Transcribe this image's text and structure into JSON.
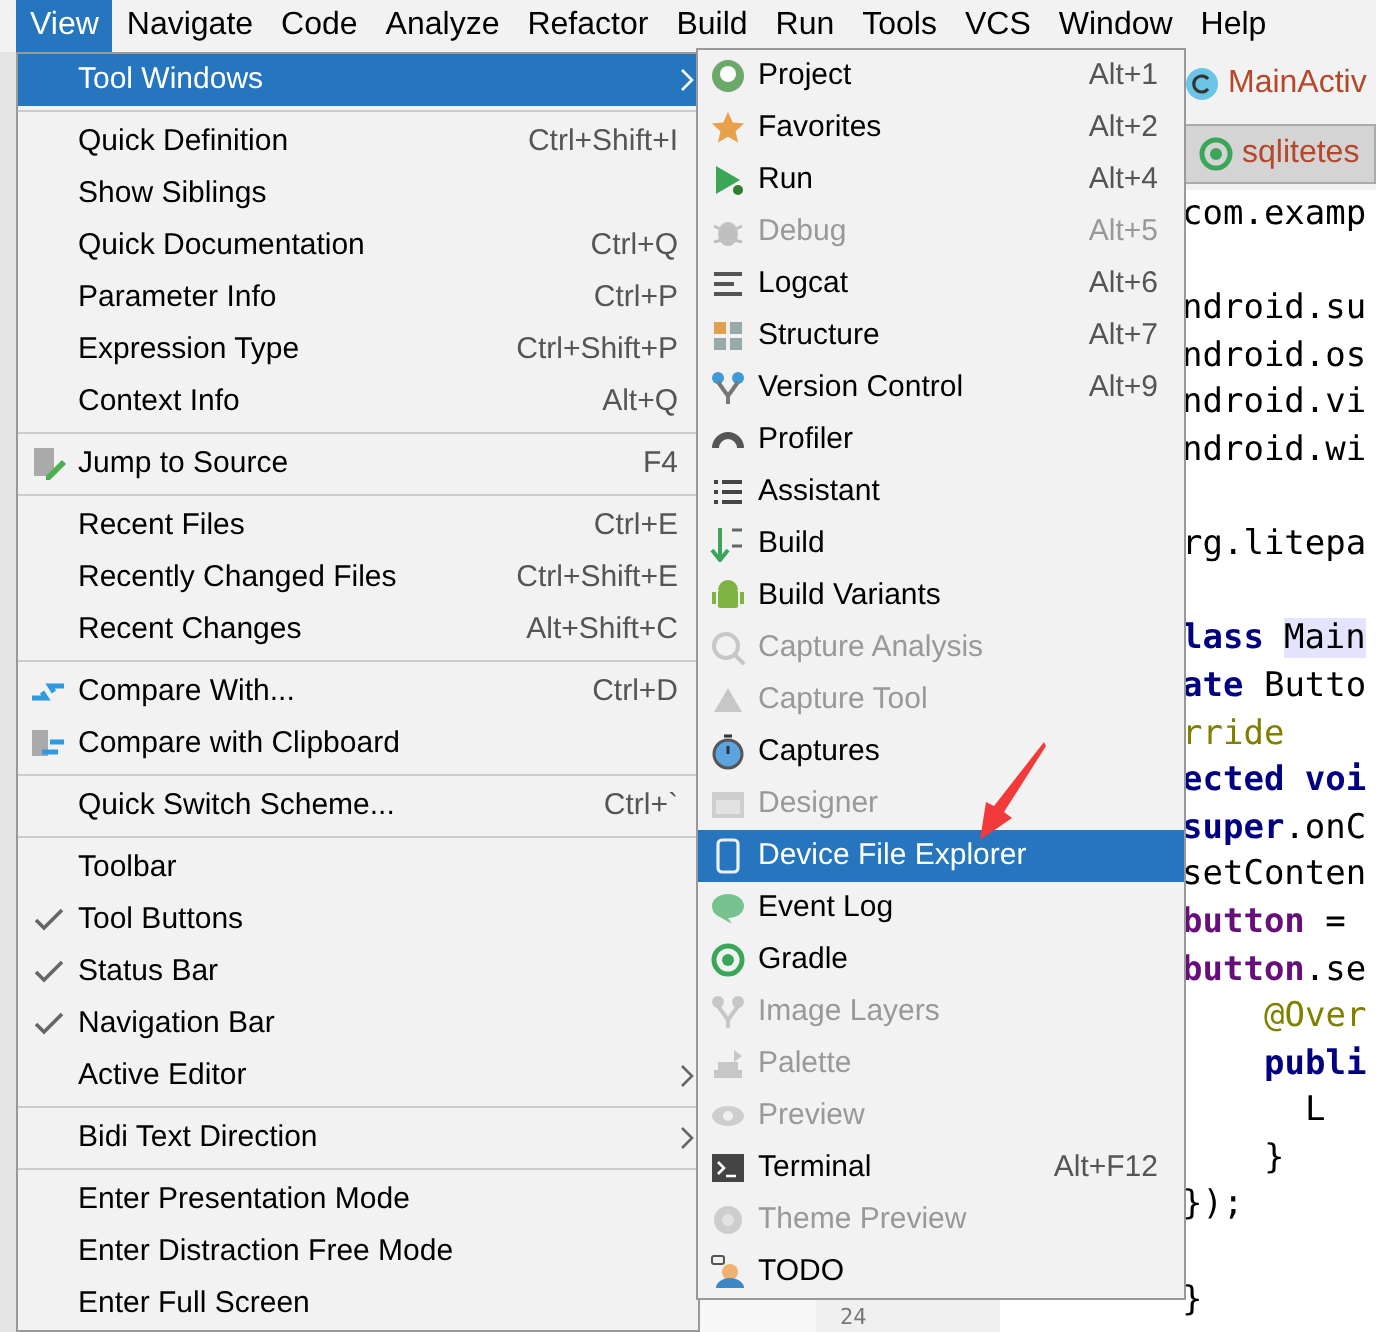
{
  "menubar": [
    {
      "label": "View",
      "selected": true
    },
    {
      "label": "Navigate",
      "selected": false
    },
    {
      "label": "Code",
      "selected": false
    },
    {
      "label": "Analyze",
      "selected": false
    },
    {
      "label": "Refactor",
      "selected": false
    },
    {
      "label": "Build",
      "selected": false
    },
    {
      "label": "Run",
      "selected": false
    },
    {
      "label": "Tools",
      "selected": false
    },
    {
      "label": "VCS",
      "selected": false
    },
    {
      "label": "Window",
      "selected": false
    },
    {
      "label": "Help",
      "selected": false
    }
  ],
  "view_menu": {
    "groups": [
      [
        {
          "label": "Tool Windows",
          "checked": false,
          "submenu": true,
          "selected": true
        }
      ],
      [
        {
          "label": "Quick Definition",
          "shortcut": "Ctrl+Shift+I",
          "checked": false,
          "submenu": false,
          "selected": false
        },
        {
          "label": "Show Siblings",
          "checked": false,
          "submenu": false,
          "selected": false
        },
        {
          "label": "Quick Documentation",
          "shortcut": "Ctrl+Q",
          "checked": false,
          "submenu": false,
          "selected": false
        },
        {
          "label": "Parameter Info",
          "shortcut": "Ctrl+P",
          "checked": false,
          "submenu": false,
          "selected": false
        },
        {
          "label": "Expression Type",
          "shortcut": "Ctrl+Shift+P",
          "checked": false,
          "submenu": false,
          "selected": false
        },
        {
          "label": "Context Info",
          "shortcut": "Alt+Q",
          "checked": false,
          "submenu": false,
          "selected": false
        }
      ],
      [
        {
          "label": "Jump to Source",
          "shortcut": "F4",
          "checked": false,
          "submenu": false,
          "selected": false
        }
      ],
      [
        {
          "label": "Recent Files",
          "shortcut": "Ctrl+E",
          "checked": false,
          "submenu": false,
          "selected": false
        },
        {
          "label": "Recently Changed Files",
          "shortcut": "Ctrl+Shift+E",
          "checked": false,
          "submenu": false,
          "selected": false
        },
        {
          "label": "Recent Changes",
          "shortcut": "Alt+Shift+C",
          "checked": false,
          "submenu": false,
          "selected": false
        }
      ],
      [
        {
          "label": "Compare With...",
          "shortcut": "Ctrl+D",
          "checked": false,
          "submenu": false,
          "selected": false
        },
        {
          "label": "Compare with Clipboard",
          "checked": false,
          "submenu": false,
          "selected": false
        }
      ],
      [
        {
          "label": "Quick Switch Scheme...",
          "shortcut": "Ctrl+`",
          "checked": false,
          "submenu": false,
          "selected": false
        }
      ],
      [
        {
          "label": "Toolbar",
          "checked": false,
          "submenu": false,
          "selected": false
        },
        {
          "label": "Tool Buttons",
          "checked": true,
          "submenu": false,
          "selected": false
        },
        {
          "label": "Status Bar",
          "checked": true,
          "submenu": false,
          "selected": false
        },
        {
          "label": "Navigation Bar",
          "checked": true,
          "submenu": false,
          "selected": false
        },
        {
          "label": "Active Editor",
          "checked": false,
          "submenu": true,
          "selected": false
        }
      ],
      [
        {
          "label": "Bidi Text Direction",
          "checked": false,
          "submenu": true,
          "selected": false
        }
      ],
      [
        {
          "label": "Enter Presentation Mode",
          "checked": false,
          "submenu": false,
          "selected": false
        },
        {
          "label": "Enter Distraction Free Mode",
          "checked": false,
          "submenu": false,
          "selected": false
        },
        {
          "label": "Enter Full Screen",
          "checked": false,
          "submenu": false,
          "selected": false
        }
      ]
    ]
  },
  "tool_windows_menu": [
    {
      "label": "Project",
      "shortcut": "Alt+1",
      "disabled": false,
      "selected": false
    },
    {
      "label": "Favorites",
      "shortcut": "Alt+2",
      "disabled": false,
      "selected": false
    },
    {
      "label": "Run",
      "shortcut": "Alt+4",
      "disabled": false,
      "selected": false
    },
    {
      "label": "Debug",
      "shortcut": "Alt+5",
      "disabled": true,
      "selected": false
    },
    {
      "label": "Logcat",
      "shortcut": "Alt+6",
      "disabled": false,
      "selected": false
    },
    {
      "label": "Structure",
      "shortcut": "Alt+7",
      "disabled": false,
      "selected": false
    },
    {
      "label": "Version Control",
      "shortcut": "Alt+9",
      "disabled": false,
      "selected": false
    },
    {
      "label": "Profiler",
      "disabled": false,
      "selected": false
    },
    {
      "label": "Assistant",
      "disabled": false,
      "selected": false
    },
    {
      "label": "Build",
      "disabled": false,
      "selected": false
    },
    {
      "label": "Build Variants",
      "disabled": false,
      "selected": false
    },
    {
      "label": "Capture Analysis",
      "disabled": true,
      "selected": false
    },
    {
      "label": "Capture Tool",
      "disabled": true,
      "selected": false
    },
    {
      "label": "Captures",
      "disabled": false,
      "selected": false
    },
    {
      "label": "Designer",
      "disabled": true,
      "selected": false
    },
    {
      "label": "Device File Explorer",
      "disabled": false,
      "selected": true
    },
    {
      "label": "Event Log",
      "disabled": false,
      "selected": false
    },
    {
      "label": "Gradle",
      "disabled": false,
      "selected": false
    },
    {
      "label": "Image Layers",
      "disabled": true,
      "selected": false
    },
    {
      "label": "Palette",
      "disabled": true,
      "selected": false
    },
    {
      "label": "Preview",
      "disabled": true,
      "selected": false
    },
    {
      "label": "Terminal",
      "shortcut": "Alt+F12",
      "disabled": false,
      "selected": false
    },
    {
      "label": "Theme Preview",
      "disabled": true,
      "selected": false
    },
    {
      "label": "TODO",
      "disabled": false,
      "selected": false
    }
  ],
  "editor": {
    "tabs": [
      {
        "label": "MainActiv",
        "selected": false
      },
      {
        "label": "sqlitetes",
        "selected": true
      }
    ],
    "gutter_line": "24",
    "lines": [
      {
        "blank_line_before": false,
        "indented": false,
        "segments": [
          {
            "text": "com.examp",
            "kind": "plain"
          }
        ]
      },
      {
        "blank_line_before": true,
        "indented": false,
        "segments": [
          {
            "text": "ndroid.su",
            "kind": "plain"
          }
        ]
      },
      {
        "blank_line_before": false,
        "indented": false,
        "segments": [
          {
            "text": "ndroid.os",
            "kind": "plain"
          }
        ]
      },
      {
        "blank_line_before": false,
        "indented": false,
        "segments": [
          {
            "text": "ndroid.vi",
            "kind": "plain"
          }
        ]
      },
      {
        "blank_line_before": false,
        "indented": false,
        "segments": [
          {
            "text": "ndroid.wi",
            "kind": "plain"
          }
        ]
      },
      {
        "blank_line_before": true,
        "indented": false,
        "segments": [
          {
            "text": "rg.litepa",
            "kind": "plain"
          }
        ]
      },
      {
        "blank_line_before": true,
        "indented": false,
        "segments": [
          {
            "text": "lass",
            "kind": "keyword"
          },
          {
            "text": "Main",
            "kind": "highlight"
          }
        ]
      },
      {
        "blank_line_before": false,
        "indented": false,
        "segments": [
          {
            "text": "ate",
            "kind": "keyword"
          },
          {
            "text": " Butto",
            "kind": "plain"
          }
        ]
      },
      {
        "blank_line_before": false,
        "indented": false,
        "segments": [
          {
            "text": "rride",
            "kind": "annotation"
          }
        ]
      },
      {
        "blank_line_before": false,
        "indented": false,
        "segments": [
          {
            "text": "ected voi",
            "kind": "keyword"
          }
        ]
      },
      {
        "blank_line_before": false,
        "indented": false,
        "segments": [
          {
            "text": "super",
            "kind": "keyword"
          },
          {
            "text": ".onC",
            "kind": "plain"
          }
        ]
      },
      {
        "blank_line_before": false,
        "indented": false,
        "segments": [
          {
            "text": "setConten",
            "kind": "plain"
          }
        ]
      },
      {
        "blank_line_before": false,
        "indented": false,
        "segments": [
          {
            "text": "button",
            "kind": "field"
          },
          {
            "text": " =",
            "kind": "plain"
          }
        ]
      },
      {
        "blank_line_before": false,
        "indented": false,
        "segments": [
          {
            "text": "button",
            "kind": "field"
          },
          {
            "text": ".se",
            "kind": "plain"
          }
        ]
      },
      {
        "blank_line_before": false,
        "indented": true,
        "segments": [
          {
            "text": "@Over",
            "kind": "annotation"
          }
        ]
      },
      {
        "blank_line_before": false,
        "indented": true,
        "segments": [
          {
            "text": "publi",
            "kind": "keyword"
          }
        ]
      },
      {
        "blank_line_before": false,
        "indented": true,
        "segments": [
          {
            "text": "  L",
            "kind": "plain"
          }
        ]
      },
      {
        "blank_line_before": false,
        "indented": true,
        "segments": [
          {
            "text": "}",
            "kind": "plain"
          }
        ]
      },
      {
        "blank_line_before": false,
        "indented": false,
        "segments": [
          {
            "text": "});",
            "kind": "plain"
          }
        ]
      },
      {
        "blank_line_before": true,
        "indented": false,
        "segments": [
          {
            "text": "}",
            "kind": "plain"
          }
        ]
      }
    ]
  }
}
